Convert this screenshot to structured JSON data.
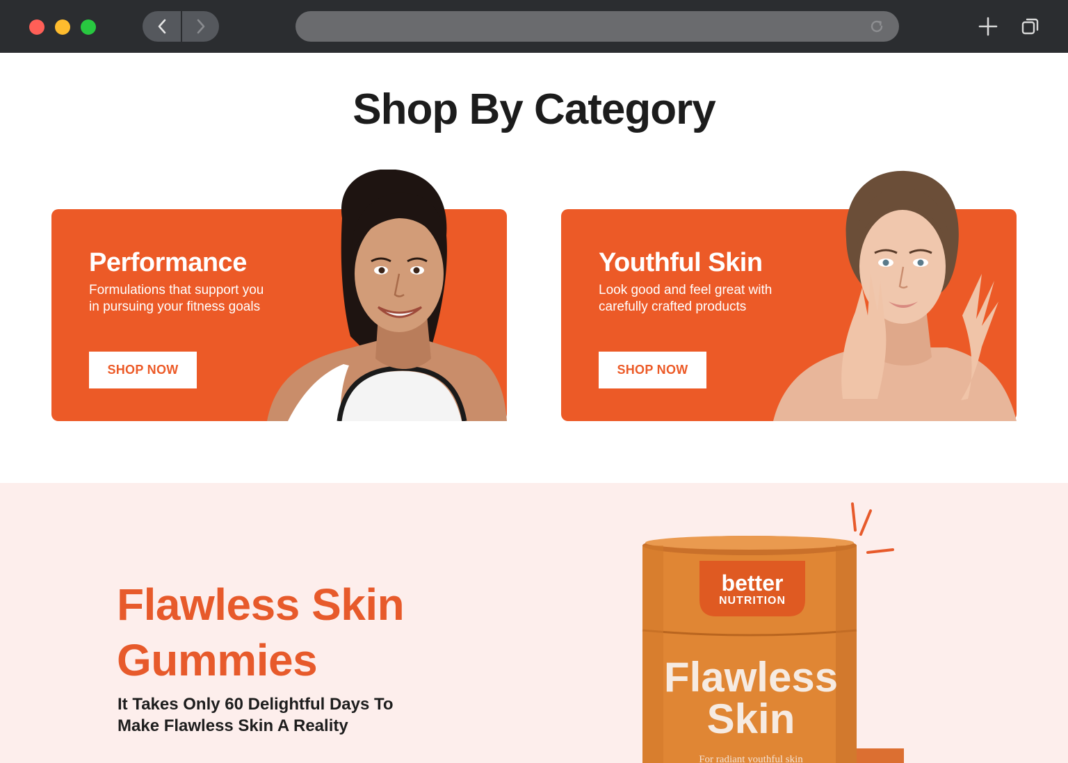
{
  "browser": {
    "icons": {
      "back": "chevron-left-icon",
      "forward": "chevron-right-icon",
      "reload": "reload-icon",
      "new_tab": "plus-icon",
      "tabs": "tabs-icon"
    }
  },
  "section": {
    "heading": "Shop By Category"
  },
  "categories": [
    {
      "title": "Performance",
      "description": "Formulations that support you in pursuing your fitness goals",
      "button": "SHOP NOW"
    },
    {
      "title": "Youthful Skin",
      "description": "Look good and feel great with carefully crafted products",
      "button": "SHOP NOW"
    }
  ],
  "product": {
    "title": "Flawless Skin Gummies",
    "subtitle": "It Takes Only 60 Delightful Days To Make Flawless Skin A Reality",
    "jar": {
      "brand_top": "better",
      "brand_bottom": "NUTRITION",
      "name_line1": "Flawless",
      "name_line2": "Skin",
      "tagline": "For radiant youthful skin"
    }
  },
  "colors": {
    "brand_orange": "#ec5a27",
    "promo_bg": "#fdeeec",
    "jar_orange": "#e08634"
  }
}
